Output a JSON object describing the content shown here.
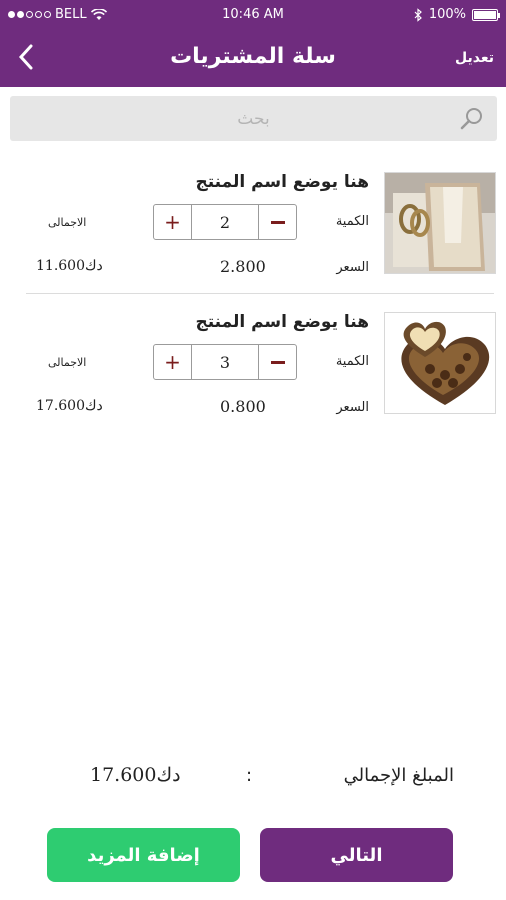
{
  "status_bar": {
    "carrier": "BELL",
    "time": "10:46 AM",
    "battery": "100%",
    "battery_level": 1.0
  },
  "nav": {
    "title": "سلة المشتريات",
    "edit_label": "تعديل"
  },
  "search": {
    "placeholder": "بحث",
    "value": ""
  },
  "labels": {
    "quantity": "الكمية",
    "price": "السعر",
    "total": "الاجمالى"
  },
  "cart_items": [
    {
      "name": "هنا يوضع اسم المنتج",
      "quantity": "2",
      "price": "2.800",
      "total": "11.600دك",
      "thumbnail": "invitation-card"
    },
    {
      "name": "هنا يوضع اسم المنتج",
      "quantity": "3",
      "price": "0.800",
      "total": "17.600دك",
      "thumbnail": "chocolate-heart-box"
    }
  ],
  "summary": {
    "label": "المبلغ الإجمالي",
    "separator": ":",
    "value": "17.600دك"
  },
  "actions": {
    "next_label": "التالي",
    "add_more_label": "إضافة المزيد"
  },
  "colors": {
    "primary": "#6f2c7e",
    "accent_green": "#2ecc71",
    "stepper_text": "#7a1d1d"
  }
}
